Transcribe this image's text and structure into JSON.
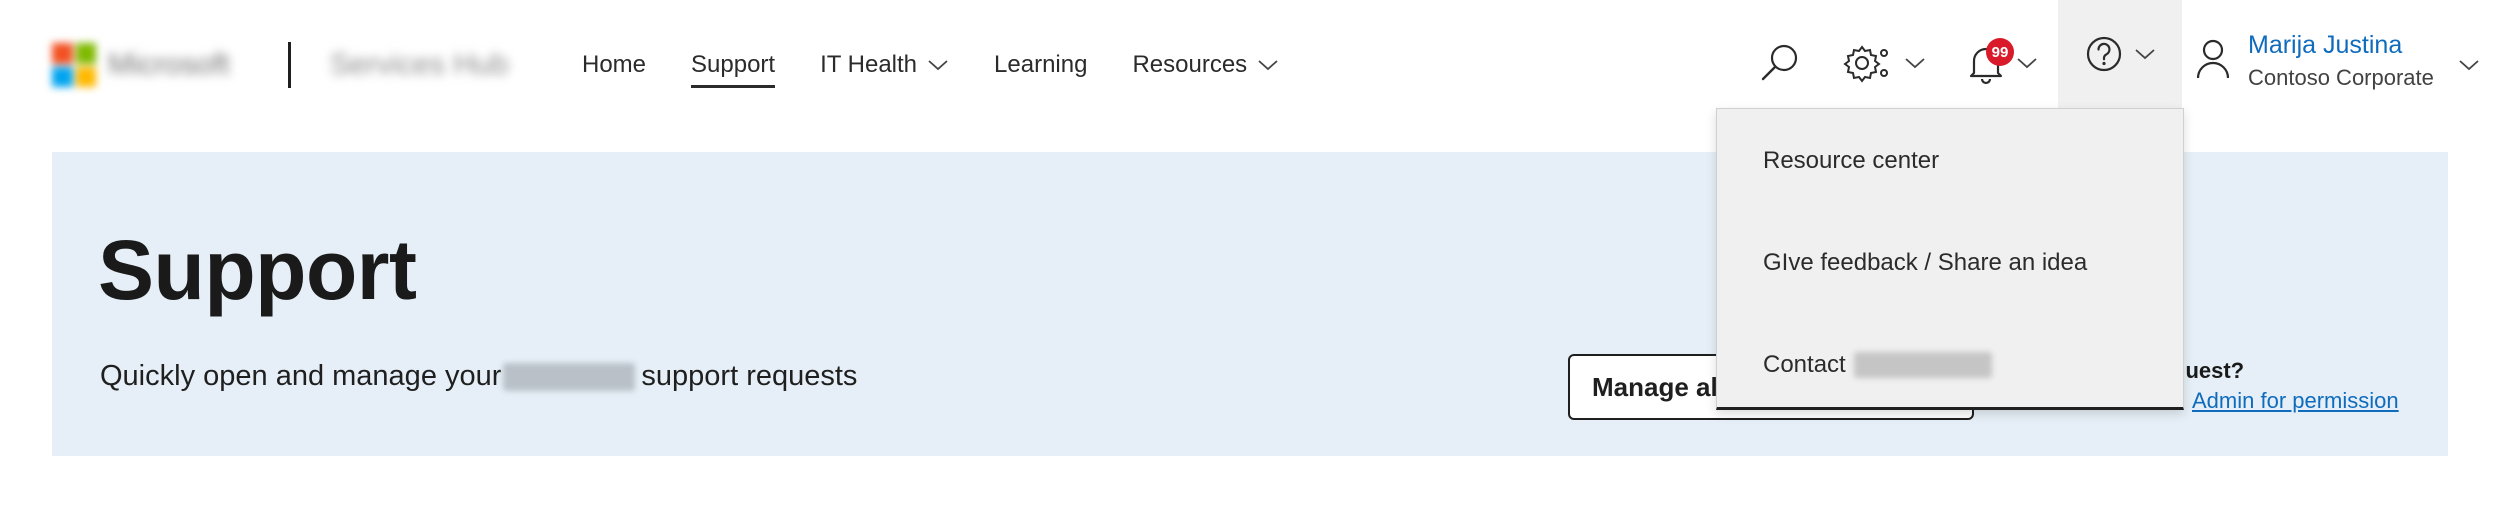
{
  "header": {
    "brand": "Microsoft",
    "app_name": "Services Hub",
    "nav": [
      {
        "label": "Home",
        "active": false,
        "has_dropdown": false
      },
      {
        "label": "Support",
        "active": true,
        "has_dropdown": false
      },
      {
        "label": "IT Health",
        "active": false,
        "has_dropdown": true
      },
      {
        "label": "Learning",
        "active": false,
        "has_dropdown": false
      },
      {
        "label": "Resources",
        "active": false,
        "has_dropdown": true
      }
    ],
    "notifications_count": "99",
    "icons": {
      "search": "search-icon",
      "settings": "settings-gear-icon",
      "notifications": "bell-icon",
      "help": "help-circle-icon",
      "user": "person-icon"
    },
    "user": {
      "name": "Marija Justina",
      "org": "Contoso Corporate"
    }
  },
  "hero": {
    "title": "Support",
    "subtitle_before": "Quickly open and manage your",
    "subtitle_after": "support requests",
    "manage_button_label": "Manage all",
    "access_question": "quest?",
    "access_link": "Admin for permission"
  },
  "help_menu": {
    "items": [
      {
        "label": "Resource center"
      },
      {
        "label": "GIve feedback / Share an idea"
      },
      {
        "label": "Contact"
      }
    ]
  },
  "colors": {
    "accent": "#0f6cbd",
    "hero_bg": "#e6eff7",
    "badge": "#d91a2a",
    "menu_bg": "#f0f0f0"
  }
}
